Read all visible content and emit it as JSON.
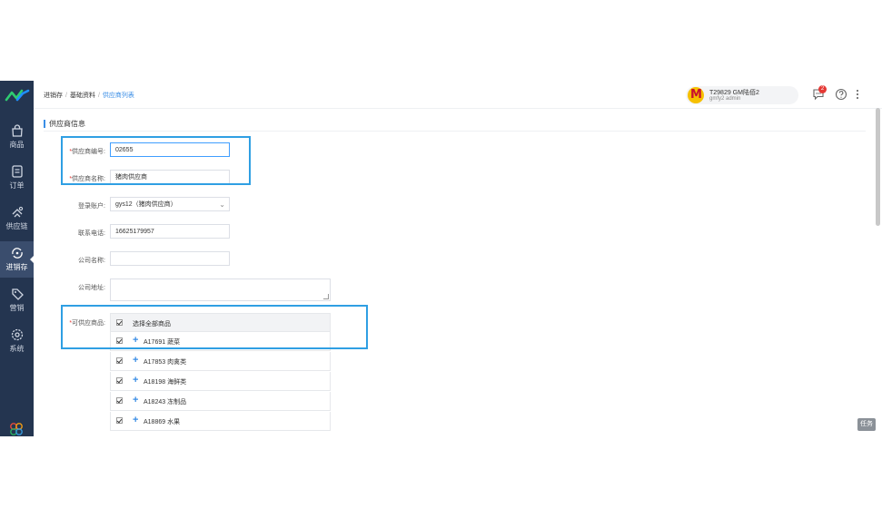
{
  "sidebar": {
    "items": [
      {
        "label": "商品",
        "icon": "shopping-bag-icon"
      },
      {
        "label": "订单",
        "icon": "order-doc-icon"
      },
      {
        "label": "供应链",
        "icon": "supply-chain-icon"
      },
      {
        "label": "进销存",
        "icon": "inventory-icon",
        "active": true
      },
      {
        "label": "营销",
        "icon": "tag-icon"
      },
      {
        "label": "系统",
        "icon": "gear-icon"
      }
    ]
  },
  "header": {
    "breadcrumb": [
      "进销存",
      "基础资料",
      "供应商列表"
    ],
    "store_name": "T29829 GM陆佰2",
    "store_user": "gmfy2  admin",
    "notification_count": "2"
  },
  "form": {
    "section_title": "供应商信息",
    "fields": {
      "supplier_code": {
        "label": "供应商编号:",
        "value": "02655",
        "required": true
      },
      "supplier_name": {
        "label": "供应商名称:",
        "value": "猪肉供应商",
        "required": true
      },
      "login_account": {
        "label": "登录账户:",
        "value": "gys12（猪肉供应商）"
      },
      "phone": {
        "label": "联系电话:",
        "value": "16625179957"
      },
      "company_name": {
        "label": "公司名称:",
        "value": ""
      },
      "company_address": {
        "label": "公司地址:",
        "value": ""
      },
      "goods": {
        "label": "可供应商品:",
        "required": true
      }
    },
    "goods_list": {
      "select_all": "选择全部商品",
      "items": [
        {
          "label": "A17691 蔬菜",
          "checked": true
        },
        {
          "label": "A17853 肉禽类",
          "checked": true
        },
        {
          "label": "A18198 海鲜类",
          "checked": true
        },
        {
          "label": "A18243 冻制品",
          "checked": true
        },
        {
          "label": "A18869 水果",
          "checked": true
        }
      ]
    }
  },
  "task_button": "任务",
  "colors": {
    "sidebar_bg": "#243550",
    "accent": "#3a8ee6",
    "highlight": "#2f9fe3",
    "required": "#e53935"
  }
}
